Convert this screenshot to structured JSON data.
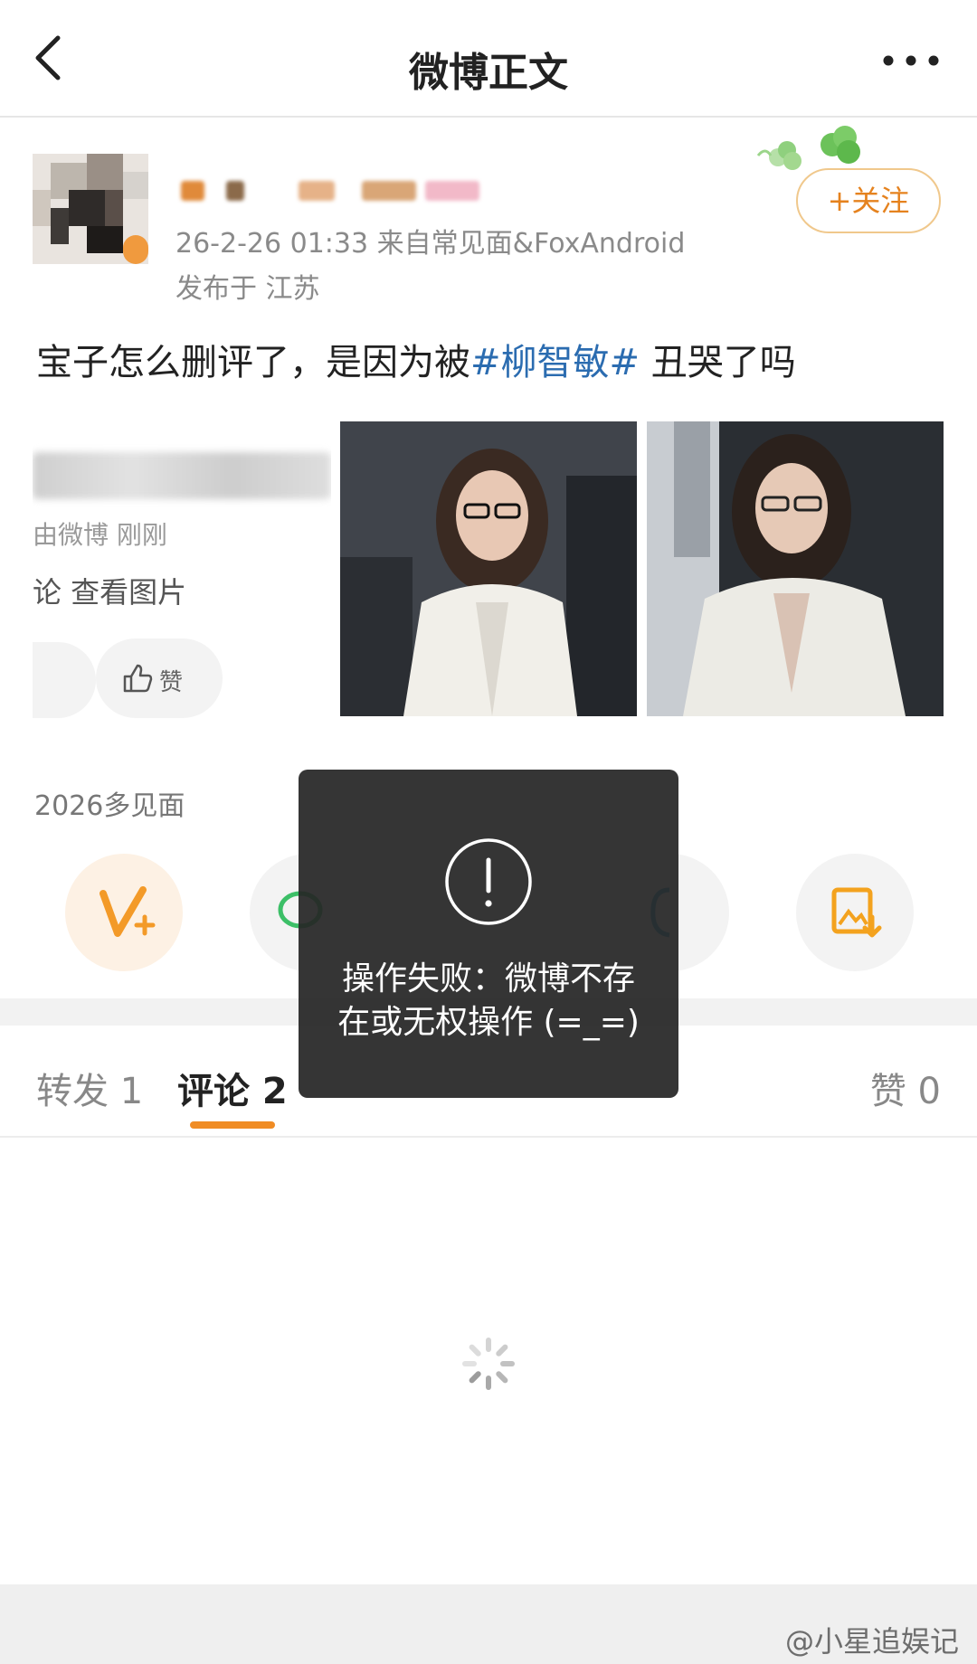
{
  "nav": {
    "title": "微博正文",
    "back_icon": "chevron-left-icon",
    "more_icon": "more-dots-icon"
  },
  "author": {
    "meta": "26-2-26 01:33  来自常见面&FoxAndroid",
    "location": "发布于 江苏",
    "follow_label": "+关注"
  },
  "post": {
    "text_before": "宝子怎么删评了，是因为被",
    "topic": "#柳智敏#",
    "text_after": " 丑哭了吗"
  },
  "snippet": {
    "source": "由微博  刚刚",
    "view_images": "论 查看图片",
    "like_label": "赞"
  },
  "hint": "2026多见面",
  "tabs": {
    "repost": "转发 1",
    "comment": "评论 2",
    "like": "赞 0"
  },
  "toast": {
    "message_line1": "操作失败：微博不存",
    "message_line2": "在或无权操作 (=_=)"
  },
  "watermark": "@小星追娱记",
  "colors": {
    "accent": "#f08c24",
    "topic": "#2b6cb0",
    "follow": "#e5821e"
  }
}
